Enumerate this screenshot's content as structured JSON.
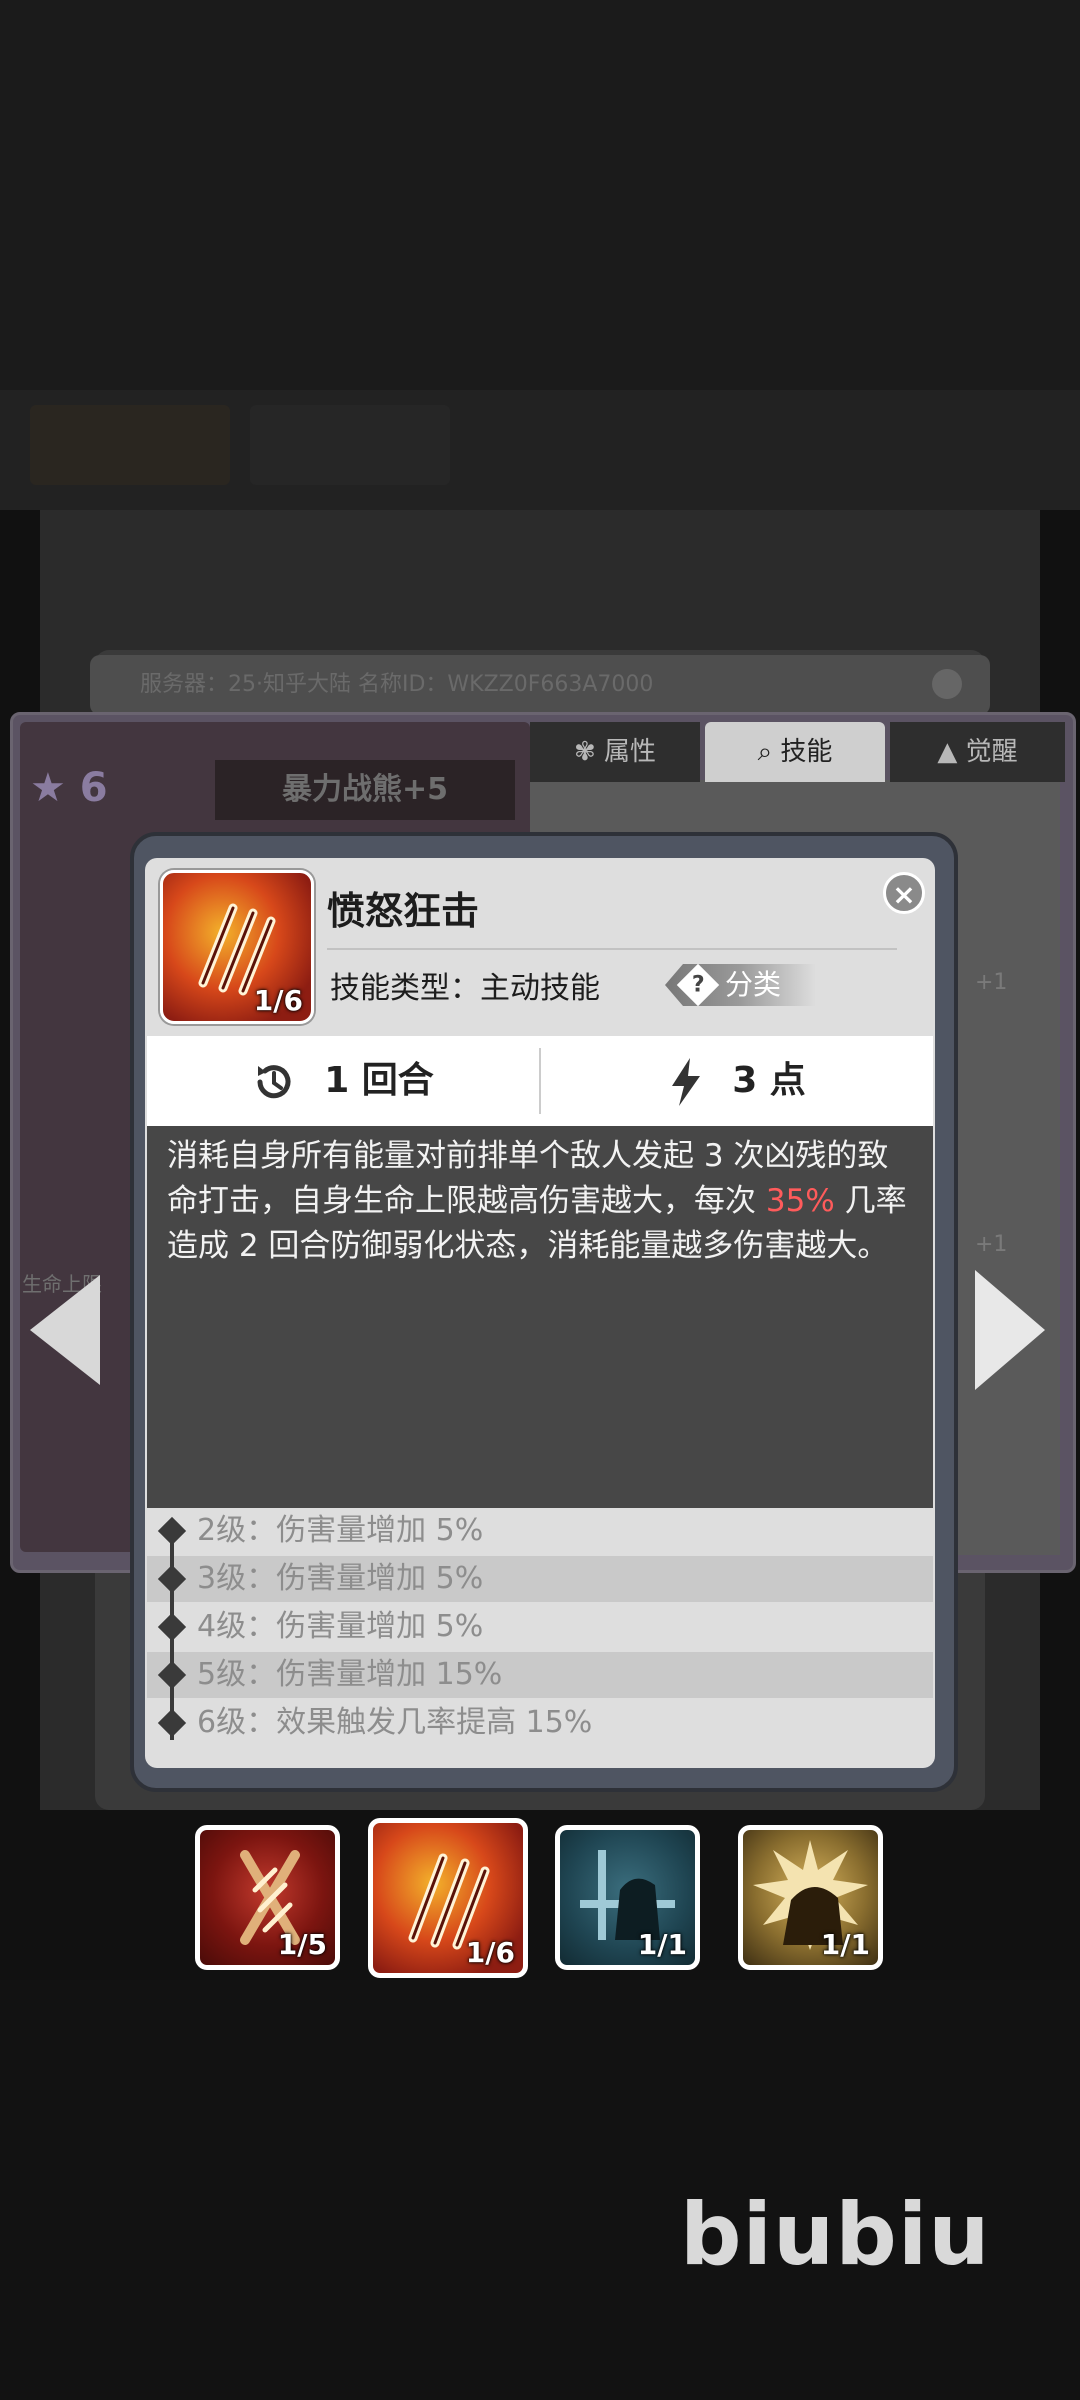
{
  "background": {
    "info_bar": "服务器：25·知乎大陆   名称ID：WKZZ0F663A7000"
  },
  "hero_panel": {
    "star_count": "★ 6",
    "hero_name": "暴力战熊+5",
    "side_label": "生命上限",
    "plus_labels": [
      "+1",
      "+1"
    ],
    "tabs": [
      {
        "icon": "attribute-icon",
        "label": "属性"
      },
      {
        "icon": "skill-icon",
        "label": "技能"
      },
      {
        "icon": "awaken-icon",
        "label": "觉醒"
      }
    ]
  },
  "skill_dialog": {
    "title": "愤怒狂击",
    "icon_badge": "1/6",
    "type_label": "技能类型：主动技能",
    "category_label": "分类",
    "category_q": "?",
    "close_symbol": "×",
    "cooldown": "1 回合",
    "cost": "3 点",
    "description": {
      "part1": "消耗自身所有能量对前排单个敌人发起 3 次凶残的致命打击，自身生命上限越高伤害越大，每次 ",
      "highlight": "35%",
      "part2": " 几率造成 2 回合防御弱化状态，消耗能量越多伤害越大。"
    },
    "levels": [
      "2级：伤害量增加 5%",
      "3级：伤害量增加 5%",
      "4级：伤害量增加 5%",
      "5级：伤害量增加 15%",
      "6级：效果触发几率提高 15%"
    ],
    "highlight_color": "#ff5b5b"
  },
  "skill_slots": [
    {
      "icon": "claw-cross-skill-icon",
      "badge": "1/5"
    },
    {
      "icon": "rage-strike-skill-icon",
      "badge": "1/6"
    },
    {
      "icon": "bear-shield-skill-icon",
      "badge": "1/1"
    },
    {
      "icon": "bear-roar-skill-icon",
      "badge": "1/1"
    }
  ],
  "watermark": "biubiu"
}
